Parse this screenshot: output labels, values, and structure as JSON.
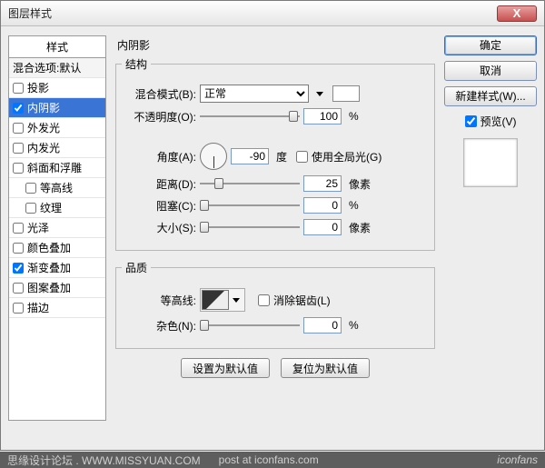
{
  "window": {
    "title": "图层样式",
    "close": "X"
  },
  "styles": {
    "header": "样式",
    "blend": "混合选项:默认",
    "items": [
      {
        "label": "投影",
        "checked": false,
        "selected": false
      },
      {
        "label": "内阴影",
        "checked": true,
        "selected": true
      },
      {
        "label": "外发光",
        "checked": false,
        "selected": false
      },
      {
        "label": "内发光",
        "checked": false,
        "selected": false
      },
      {
        "label": "斜面和浮雕",
        "checked": false,
        "selected": false
      },
      {
        "label": "等高线",
        "checked": false,
        "selected": false,
        "indent": true
      },
      {
        "label": "纹理",
        "checked": false,
        "selected": false,
        "indent": true
      },
      {
        "label": "光泽",
        "checked": false,
        "selected": false
      },
      {
        "label": "颜色叠加",
        "checked": false,
        "selected": false
      },
      {
        "label": "渐变叠加",
        "checked": true,
        "selected": false
      },
      {
        "label": "图案叠加",
        "checked": false,
        "selected": false
      },
      {
        "label": "描边",
        "checked": false,
        "selected": false
      }
    ]
  },
  "panel": {
    "title": "内阴影",
    "group_structure": "结构",
    "blend_mode_label": "混合模式(B):",
    "blend_mode_value": "正常",
    "opacity_label": "不透明度(O):",
    "opacity_value": "100",
    "opacity_unit": "%",
    "angle_label": "角度(A):",
    "angle_value": "-90",
    "angle_unit": "度",
    "use_global": "使用全局光(G)",
    "distance_label": "距离(D):",
    "distance_value": "25",
    "distance_unit": "像素",
    "choke_label": "阻塞(C):",
    "choke_value": "0",
    "choke_unit": "%",
    "size_label": "大小(S):",
    "size_value": "0",
    "size_unit": "像素",
    "group_quality": "品质",
    "contour_label": "等高线:",
    "antialias": "消除锯齿(L)",
    "noise_label": "杂色(N):",
    "noise_value": "0",
    "noise_unit": "%",
    "make_default": "设置为默认值",
    "reset_default": "复位为默认值"
  },
  "right": {
    "ok": "确定",
    "cancel": "取消",
    "new_style": "新建样式(W)...",
    "preview": "预览(V)"
  },
  "footer": {
    "left": "思缘设计论坛 . WWW.MISSYUAN.COM",
    "mid": "post at iconfans.com",
    "right": "iconfans"
  }
}
